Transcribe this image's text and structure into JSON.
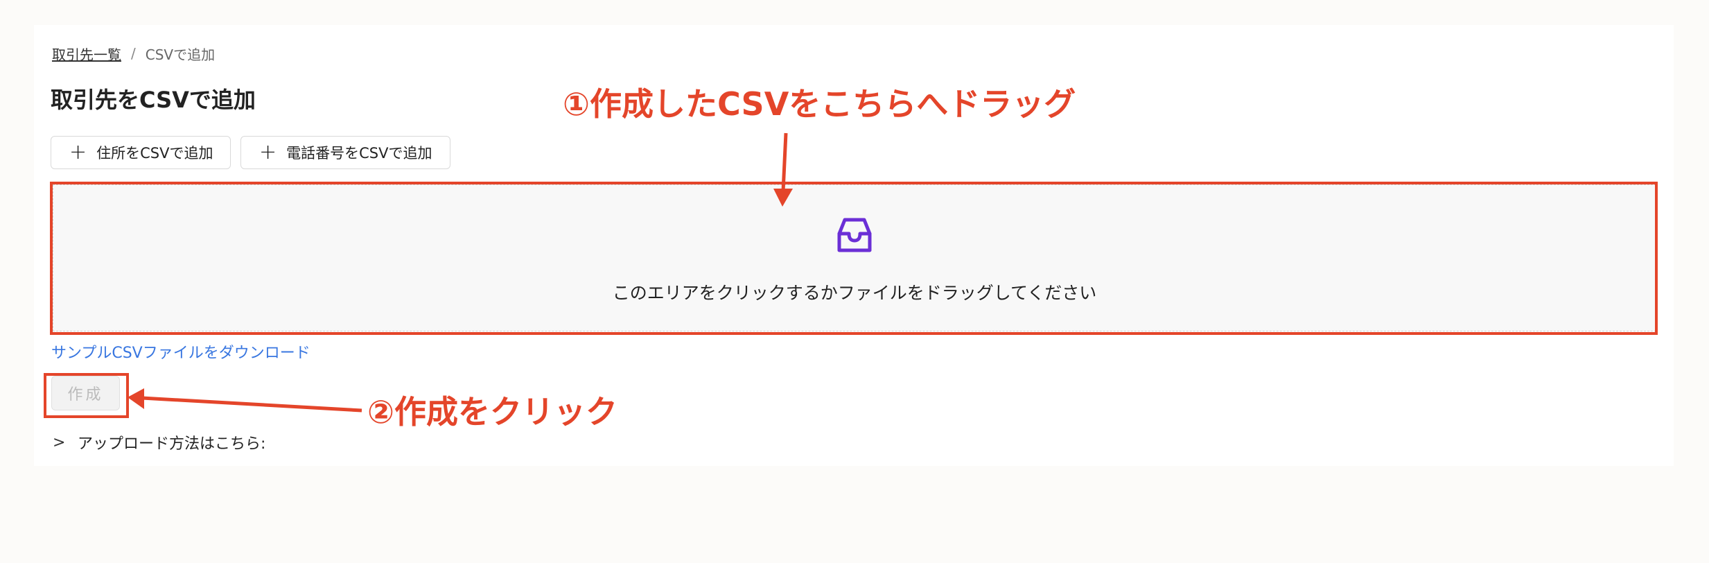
{
  "breadcrumb": {
    "parent": "取引先一覧",
    "separator": "/",
    "current": "CSVで追加"
  },
  "page": {
    "title": "取引先をCSVで追加"
  },
  "actions": {
    "add_address_label": "住所をCSVで追加",
    "add_phone_label": "電話番号をCSVで追加",
    "plus_icon": "plus-icon"
  },
  "dropzone": {
    "icon": "inbox-icon",
    "hint": "このエリアをクリックするかファイルをドラッグしてください"
  },
  "download": {
    "label": "サンプルCSVファイルをダウンロード"
  },
  "create": {
    "label": "作成",
    "disabled": true
  },
  "upload_help": {
    "label": "アップロード方法はこちら:",
    "icon": "chevron-right-icon"
  },
  "annotations": {
    "step1": "①作成したCSVをこちらへドラッグ",
    "step2": "②作成をクリック",
    "color": "#e4452a"
  },
  "colors": {
    "accent_icon": "#6b2fd6",
    "link": "#3876e0",
    "annotation": "#e4452a"
  }
}
